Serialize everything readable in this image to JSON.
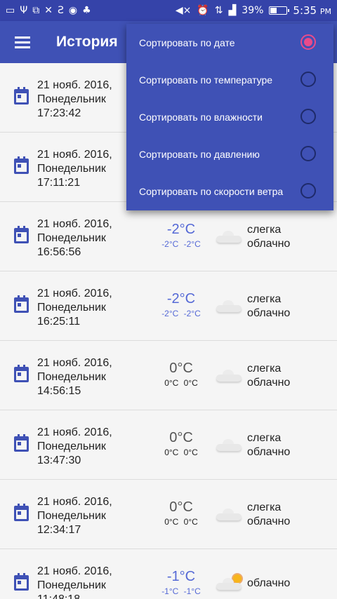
{
  "status_bar": {
    "left_icons": [
      "gallery-icon",
      "usb-icon",
      "dev-icon",
      "tools-icon",
      "s-icon",
      "shield-icon",
      "android-icon"
    ],
    "right_icons": [
      "mute-icon",
      "alarm-icon",
      "data-icon",
      "signal-icon"
    ],
    "battery": "39%",
    "battery_level": 0.39,
    "time": "5:35",
    "ampm": "PM"
  },
  "app_bar": {
    "title": "История"
  },
  "sort_menu": {
    "items": [
      {
        "label": "Сортировать по дате",
        "selected": true
      },
      {
        "label": "Сортировать по температуре",
        "selected": false
      },
      {
        "label": "Сортировать по влажности",
        "selected": false
      },
      {
        "label": "Сортировать по давлению",
        "selected": false
      },
      {
        "label": "Сортировать по скорости ветра",
        "selected": false
      }
    ],
    "accent": "#e94b8a"
  },
  "history": [
    {
      "date": "21 нояб. 2016,",
      "weekday": "Понедельник",
      "time": "17:23:42",
      "temp": "",
      "min": "",
      "max": "",
      "cond1": "",
      "cond2": "",
      "icon": ""
    },
    {
      "date": "21 нояб. 2016,",
      "weekday": "Понедельник",
      "time": "17:11:21",
      "temp": "",
      "min": "",
      "max": "",
      "cond1": "",
      "cond2": "",
      "icon": ""
    },
    {
      "date": "21 нояб. 2016,",
      "weekday": "Понедельник",
      "time": "16:56:56",
      "temp": "-2°C",
      "min": "-2°C",
      "max": "-2°C",
      "cond1": "слегка",
      "cond2": "облачно",
      "icon": "cloud-icon"
    },
    {
      "date": "21 нояб. 2016,",
      "weekday": "Понедельник",
      "time": "16:25:11",
      "temp": "-2°C",
      "min": "-2°C",
      "max": "-2°C",
      "cond1": "слегка",
      "cond2": "облачно",
      "icon": "cloud-icon"
    },
    {
      "date": "21 нояб. 2016,",
      "weekday": "Понедельник",
      "time": "14:56:15",
      "temp": "0°C",
      "min": "0°C",
      "max": "0°C",
      "cond1": "слегка",
      "cond2": "облачно",
      "icon": "cloud-icon"
    },
    {
      "date": "21 нояб. 2016,",
      "weekday": "Понедельник",
      "time": "13:47:30",
      "temp": "0°C",
      "min": "0°C",
      "max": "0°C",
      "cond1": "слегка",
      "cond2": "облачно",
      "icon": "cloud-icon"
    },
    {
      "date": "21 нояб. 2016,",
      "weekday": "Понедельник",
      "time": "12:34:17",
      "temp": "0°C",
      "min": "0°C",
      "max": "0°C",
      "cond1": "слегка",
      "cond2": "облачно",
      "icon": "cloud-icon"
    },
    {
      "date": "21 нояб. 2016,",
      "weekday": "Понедельник",
      "time": "11:48:18",
      "temp": "-1°C",
      "min": "-1°C",
      "max": "-1°C",
      "cond1": "облачно",
      "cond2": "",
      "icon": "partly-cloudy-icon"
    }
  ],
  "colors": {
    "primary": "#3f51b5",
    "status_bar": "#3543a9",
    "negative_temp": "#5569d6"
  }
}
